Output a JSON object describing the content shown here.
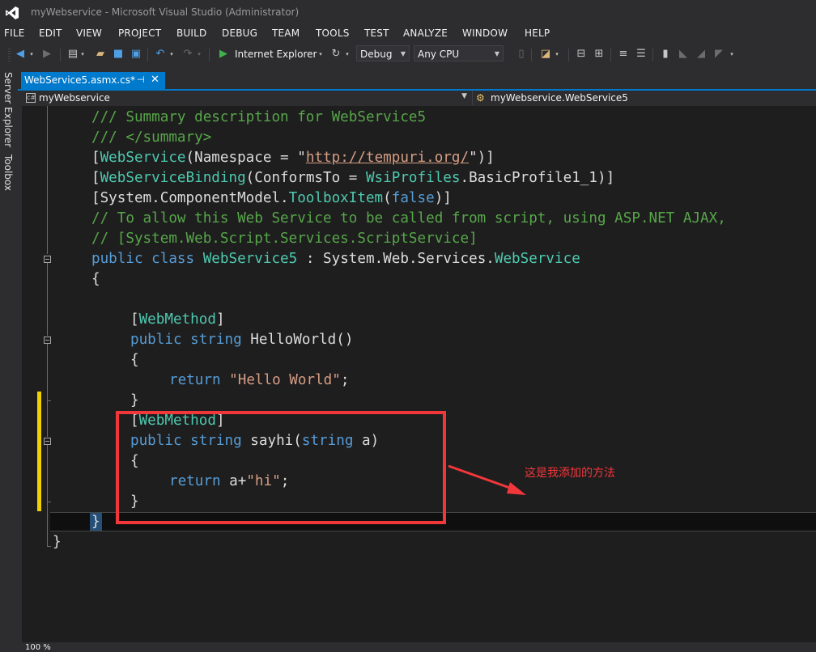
{
  "window": {
    "title": "myWebservice - Microsoft Visual Studio (Administrator)"
  },
  "menu": [
    "FILE",
    "EDIT",
    "VIEW",
    "PROJECT",
    "BUILD",
    "DEBUG",
    "TEAM",
    "TOOLS",
    "TEST",
    "ANALYZE",
    "WINDOW",
    "HELP"
  ],
  "toolbar": {
    "browser_label": "Internet Explorer",
    "config_value": "Debug",
    "platform_value": "Any CPU"
  },
  "side_tabs": {
    "server_explorer": "Server Explorer",
    "toolbox": "Toolbox"
  },
  "tab": {
    "label": "WebService5.asmx.cs*",
    "pin": "⊣",
    "close": "✕"
  },
  "nav": {
    "project": "myWebservice",
    "class": "myWebservice.WebService5"
  },
  "code": {
    "l1": "/// Summary description for WebService5",
    "l2": "/// </summary>",
    "l3": {
      "a": "[",
      "b": "WebService",
      "c": "(Namespace = \"",
      "d": "http://tempuri.org/",
      "e": "\")]"
    },
    "l4": {
      "a": "[",
      "b": "WebServiceBinding",
      "c": "(ConformsTo = ",
      "d": "WsiProfiles",
      "e": ".BasicProfile1_1)]"
    },
    "l5": {
      "a": "[System.ComponentModel.",
      "b": "ToolboxItem",
      "c": "(",
      "d": "false",
      "e": ")]"
    },
    "l6": "// To allow this Web Service to be called from script, using ASP.NET AJAX,",
    "l7": "// [System.Web.Script.Services.ScriptService]",
    "l8": {
      "a": "public",
      "b": " ",
      "c": "class",
      "d": " ",
      "e": "WebService5",
      "f": " : System.Web.Services.",
      "g": "WebService"
    },
    "l9": "{",
    "l11": {
      "a": "[",
      "b": "WebMethod",
      "c": "]"
    },
    "l12": {
      "a": "public",
      "b": " ",
      "c": "string",
      "d": " HelloWorld()"
    },
    "l13": "{",
    "l14": {
      "a": "return",
      "b": " ",
      "c": "\"Hello World\"",
      "d": ";"
    },
    "l15": "}",
    "l16": {
      "a": "[",
      "b": "WebMethod",
      "c": "]"
    },
    "l17": {
      "a": "public",
      "b": " ",
      "c": "string",
      "d": " sayhi(",
      "e": "string",
      "f": " a)"
    },
    "l18": "{",
    "l19": {
      "a": "return",
      "b": " a+",
      "c": "\"hi\"",
      "d": ";"
    },
    "l20": "}",
    "l21": "}",
    "l22": "}"
  },
  "annotation": {
    "note": "这是我添加的方法",
    "color": "#f2373b"
  },
  "zoom": "100 %"
}
